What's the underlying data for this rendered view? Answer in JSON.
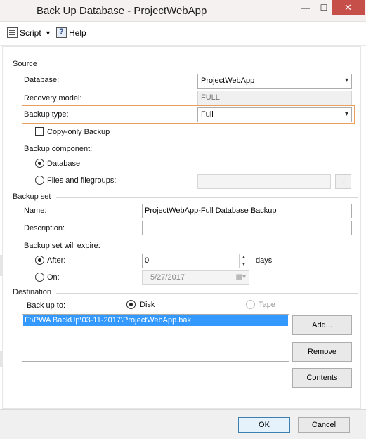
{
  "window": {
    "title": "Back Up Database - ProjectWebApp",
    "minimize": "—",
    "maximize": "☐",
    "close": "✕"
  },
  "toolbar": {
    "script_label": "Script",
    "script_dropdown": "▼",
    "help_label": "Help"
  },
  "source": {
    "section_label": "Source",
    "database_label": "Database:",
    "database_value": "ProjectWebApp",
    "recovery_model_label": "Recovery model:",
    "recovery_model_value": "FULL",
    "backup_type_label": "Backup type:",
    "backup_type_value": "Full",
    "copy_only_label": "Copy-only Backup",
    "copy_only_checked": false,
    "backup_component_label": "Backup component:",
    "component_database_label": "Database",
    "component_files_label": "Files and filegroups:",
    "files_value": "",
    "browse_label": "..."
  },
  "backup_set": {
    "section_label": "Backup set",
    "name_label": "Name:",
    "name_value": "ProjectWebApp-Full Database Backup",
    "description_label": "Description:",
    "description_value": "",
    "expire_label": "Backup set will expire:",
    "after_label": "After:",
    "after_value": "0",
    "days_label": "days",
    "on_label": "On:",
    "on_value": "5/27/2017"
  },
  "destination": {
    "section_label": "Destination",
    "backup_to_label": "Back up to:",
    "disk_label": "Disk",
    "tape_label": "Tape",
    "items": [
      "F:\\PWA BackUp\\03-11-2017\\ProjectWebApp.bak"
    ],
    "add_label": "Add...",
    "remove_label": "Remove",
    "contents_label": "Contents"
  },
  "footer": {
    "ok_label": "OK",
    "cancel_label": "Cancel"
  },
  "colors": {
    "selection": "#3399ff",
    "highlight_border": "#e8a060",
    "close_button": "#c74f4a"
  }
}
